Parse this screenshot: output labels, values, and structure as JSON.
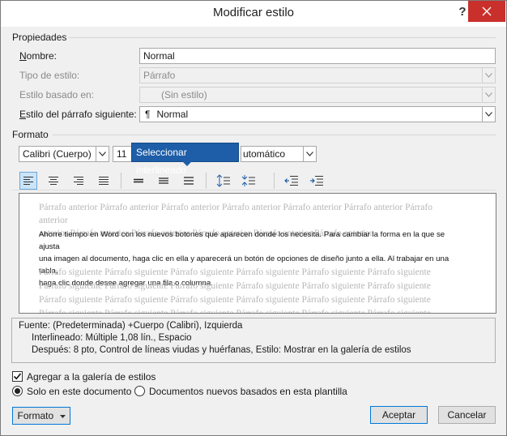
{
  "window": {
    "title": "Modificar estilo",
    "help": "?"
  },
  "properties": {
    "section_label": "Propiedades",
    "name_label": "Nombre:",
    "name_value": "Normal",
    "style_type_label": "Tipo de estilo:",
    "style_type_value": "Párrafo",
    "based_on_label": "Estilo basado en:",
    "based_on_value": "(Sin estilo)",
    "next_style_label": "Estilo del párrafo siguiente:",
    "next_style_value": "Normal",
    "next_style_icon": "¶"
  },
  "format": {
    "section_label": "Formato",
    "font": "Calibri (Cuerpo)",
    "size": "11",
    "color": "utomático",
    "tooltip": "Seleccionar interlineado"
  },
  "preview": {
    "previous_lines": [
      "Párrafo anterior Párrafo anterior Párrafo anterior Párrafo anterior Párrafo anterior Párrafo anterior Párrafo anterior",
      "anterior Párrafo anterior Párrafo anterior Párrafo anterior Párrafo anterior Párrafo anterior"
    ],
    "main_lines": [
      "Ahorre tiempo en Word con los nuevos botones que aparecen donde los necesita. Para cambiar la forma en la que se ajusta",
      "una imagen al documento, haga clic en ella y aparecerá un botón de opciones de diseño junto a ella. Al trabajar en una tabla,",
      "haga clic donde desee agregar una fila o columna."
    ],
    "next_lines": [
      "Párrafo siguiente Párrafo siguiente Párrafo siguiente Párrafo siguiente Párrafo siguiente Párrafo siguiente",
      "Párrafo siguiente Párrafo siguiente Párrafo siguiente Párrafo siguiente Párrafo siguiente Párrafo siguiente",
      "Párrafo siguiente Párrafo siguiente Párrafo siguiente Párrafo siguiente Párrafo siguiente Párrafo siguiente",
      "Párrafo siguiente Párrafo siguiente Párrafo siguiente Párrafo siguiente Párrafo siguiente Párrafo siguiente"
    ]
  },
  "description": {
    "line1": "Fuente: (Predeterminada) +Cuerpo (Calibri), Izquierda",
    "line2": "Interlineado:  Múltiple 1,08 lín., Espacio",
    "line3": "Después:  8 pto, Control de líneas viudas y huérfanas, Estilo: Mostrar en la galería de estilos"
  },
  "options": {
    "add_to_gallery": "Agregar a la galería de estilos",
    "add_to_gallery_checked": true,
    "only_this_document": "Solo en este documento",
    "new_documents": "Documentos nuevos basados en esta plantilla",
    "selected_scope": "only_this_document"
  },
  "buttons": {
    "format": "Formato",
    "accept": "Aceptar",
    "cancel": "Cancelar"
  }
}
